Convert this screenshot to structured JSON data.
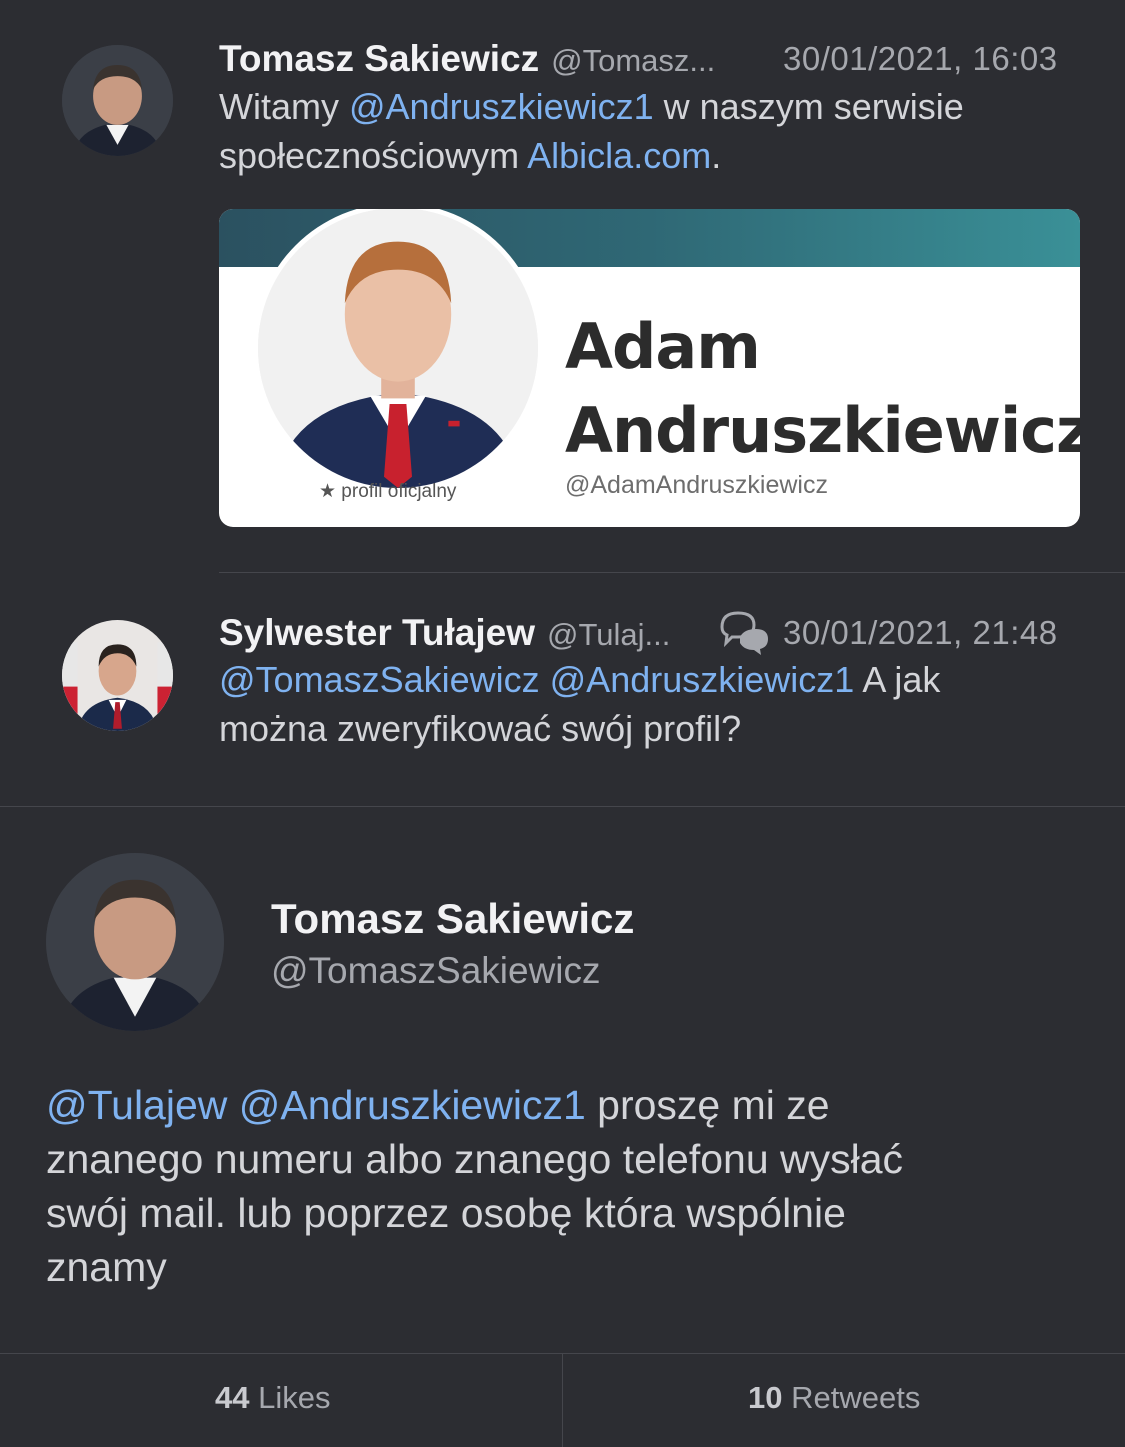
{
  "tweet1": {
    "author_name": "Tomasz Sakiewicz",
    "author_handle": "@Tomasz...",
    "timestamp": "30/01/2021, 16:03",
    "text_prefix": "Witamy ",
    "mention": "@Andruszkiewicz1",
    "text_mid": " w naszym serwisie",
    "text_line2": "społecznościowym ",
    "site_link": "Albicla.com",
    "text_end": ".",
    "card": {
      "name_line1": "Adam",
      "name_line2": "Andruszkiewicz",
      "handle": "@AdamAndruszkiewicz",
      "official_label": "★ profil oficjalny",
      "banner_color_start": "#2b5160",
      "banner_color_end": "#3a9097"
    }
  },
  "tweet2": {
    "author_name": "Sylwester Tułajew",
    "author_handle": "@Tulaj...",
    "reply_icon": "conversation-icon",
    "timestamp": "30/01/2021, 21:48",
    "mention1": "@TomaszSakiewicz",
    "mention2": "@Andruszkiewicz1",
    "text_line1_end": " A jak",
    "text_line2": "można zweryfikować swój profil?"
  },
  "main_tweet": {
    "author_name": "Tomasz Sakiewicz",
    "author_handle": "@TomaszSakiewicz",
    "mention1": "@Tulajew",
    "mention2": "@Andruszkiewicz1",
    "line1_end": " proszę mi ze",
    "line2": "znanego numeru albo znanego telefonu wysłać",
    "line3": "swój mail. lub poprzez osobę która wspólnie",
    "line4": "znamy"
  },
  "stats": {
    "likes_count": "44",
    "likes_label": "Likes",
    "retweets_count": "10",
    "retweets_label": "Retweets"
  },
  "colors": {
    "background": "#2c2d32",
    "link": "#7fb2f0",
    "divider": "#45464c"
  }
}
